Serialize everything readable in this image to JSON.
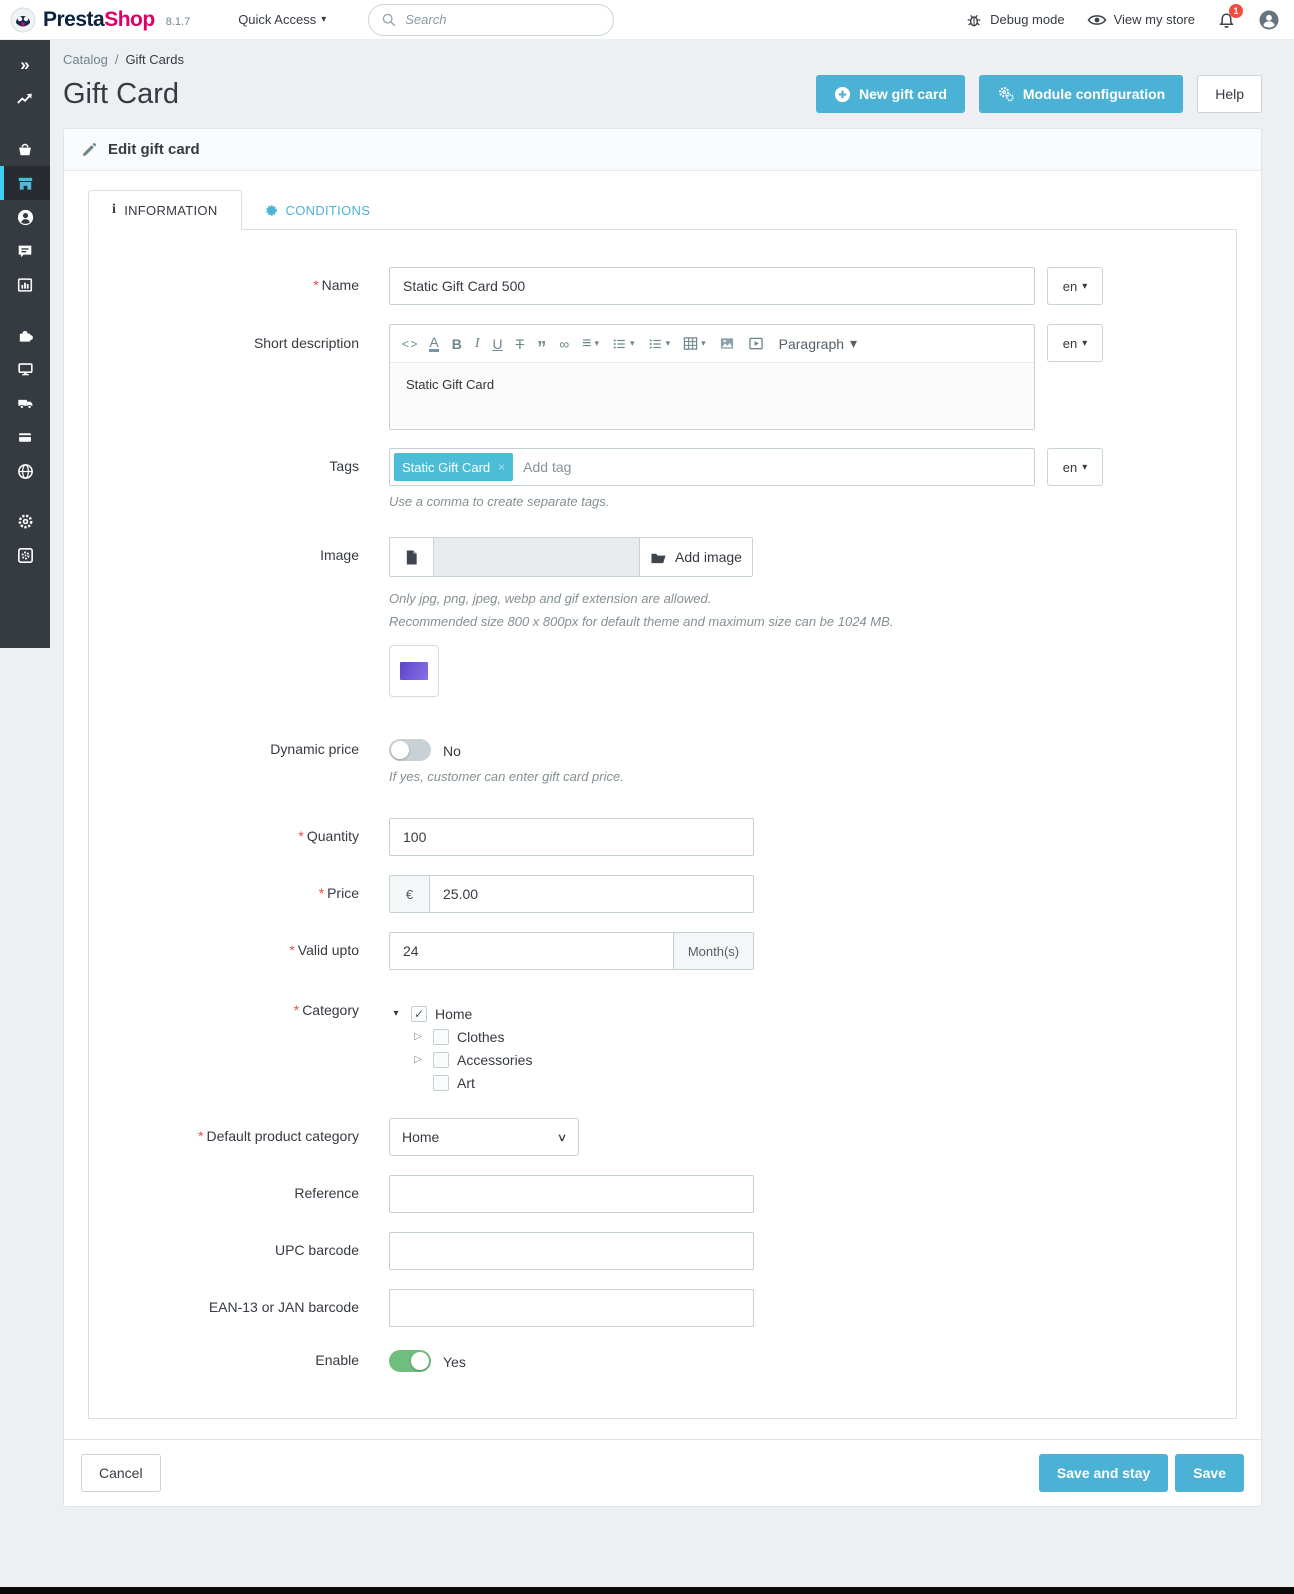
{
  "header": {
    "brand_part1": "Presta",
    "brand_part2": "Shop",
    "version": "8.1.7",
    "quick_access": "Quick Access",
    "search_placeholder": "Search",
    "debug_mode": "Debug mode",
    "view_store": "View my store",
    "notification_count": "1"
  },
  "breadcrumb": {
    "parent": "Catalog",
    "separator": "/",
    "current": "Gift Cards"
  },
  "page": {
    "title": "Gift Card"
  },
  "actions": {
    "new_gift_card": "New gift card",
    "module_configuration": "Module configuration",
    "help": "Help"
  },
  "panel": {
    "title": "Edit gift card"
  },
  "tabs": {
    "information": "INFORMATION",
    "conditions": "CONDITIONS"
  },
  "form": {
    "required_marker": "*",
    "name": {
      "label": "Name",
      "value": "Static Gift Card 500",
      "lang": "en"
    },
    "short_description": {
      "label": "Short description",
      "value": "Static Gift Card",
      "lang": "en",
      "paragraph_label": "Paragraph"
    },
    "tags": {
      "label": "Tags",
      "chip": "Static Gift Card",
      "placeholder": "Add tag",
      "lang": "en",
      "help": "Use a comma to create separate tags."
    },
    "image": {
      "label": "Image",
      "add_button": "Add image",
      "help1": "Only jpg, png, jpeg, webp and gif extension are allowed.",
      "help2": "Recommended size 800 x 800px for default theme and maximum size can be 1024 MB."
    },
    "dynamic_price": {
      "label": "Dynamic price",
      "state": "No",
      "help": "If yes, customer can enter gift card price."
    },
    "quantity": {
      "label": "Quantity",
      "value": "100"
    },
    "price": {
      "label": "Price",
      "currency": "€",
      "value": "25.00"
    },
    "valid_upto": {
      "label": "Valid upto",
      "value": "24",
      "suffix": "Month(s)"
    },
    "category": {
      "label": "Category",
      "tree": [
        {
          "label": "Home",
          "checked": true
        },
        {
          "label": "Clothes",
          "checked": false
        },
        {
          "label": "Accessories",
          "checked": false
        },
        {
          "label": "Art",
          "checked": false
        }
      ]
    },
    "default_category": {
      "label": "Default product category",
      "value": "Home"
    },
    "reference": {
      "label": "Reference"
    },
    "upc": {
      "label": "UPC barcode"
    },
    "ean": {
      "label": "EAN-13 or JAN barcode"
    },
    "enable": {
      "label": "Enable",
      "state": "Yes"
    }
  },
  "footer": {
    "cancel": "Cancel",
    "save_and_stay": "Save and stay",
    "save": "Save"
  },
  "icons": {
    "chevron_double_right": "»",
    "caret_down": "▾",
    "info_glyph": "i",
    "code": "< >",
    "text_color": "A",
    "bold": "B",
    "italic": "I",
    "underline": "U",
    "strikethrough": "T",
    "blockquote": "”",
    "link": "∞",
    "align": "≡",
    "check": "✓",
    "tree_open": "▾",
    "tree_closed": "▷",
    "remove_tag": "×",
    "select_chevron": "∨"
  },
  "colors": {
    "primary_blue": "#4cb2d5",
    "sidebar_bg": "#363a41",
    "active_accent_cyan": "#3ed2f0",
    "brand_pink": "#df0067",
    "toggle_green": "#6fbe7e",
    "badge_red": "#f54c3e",
    "tag_blue": "#4bbdd7",
    "page_bg": "#edeff2"
  }
}
